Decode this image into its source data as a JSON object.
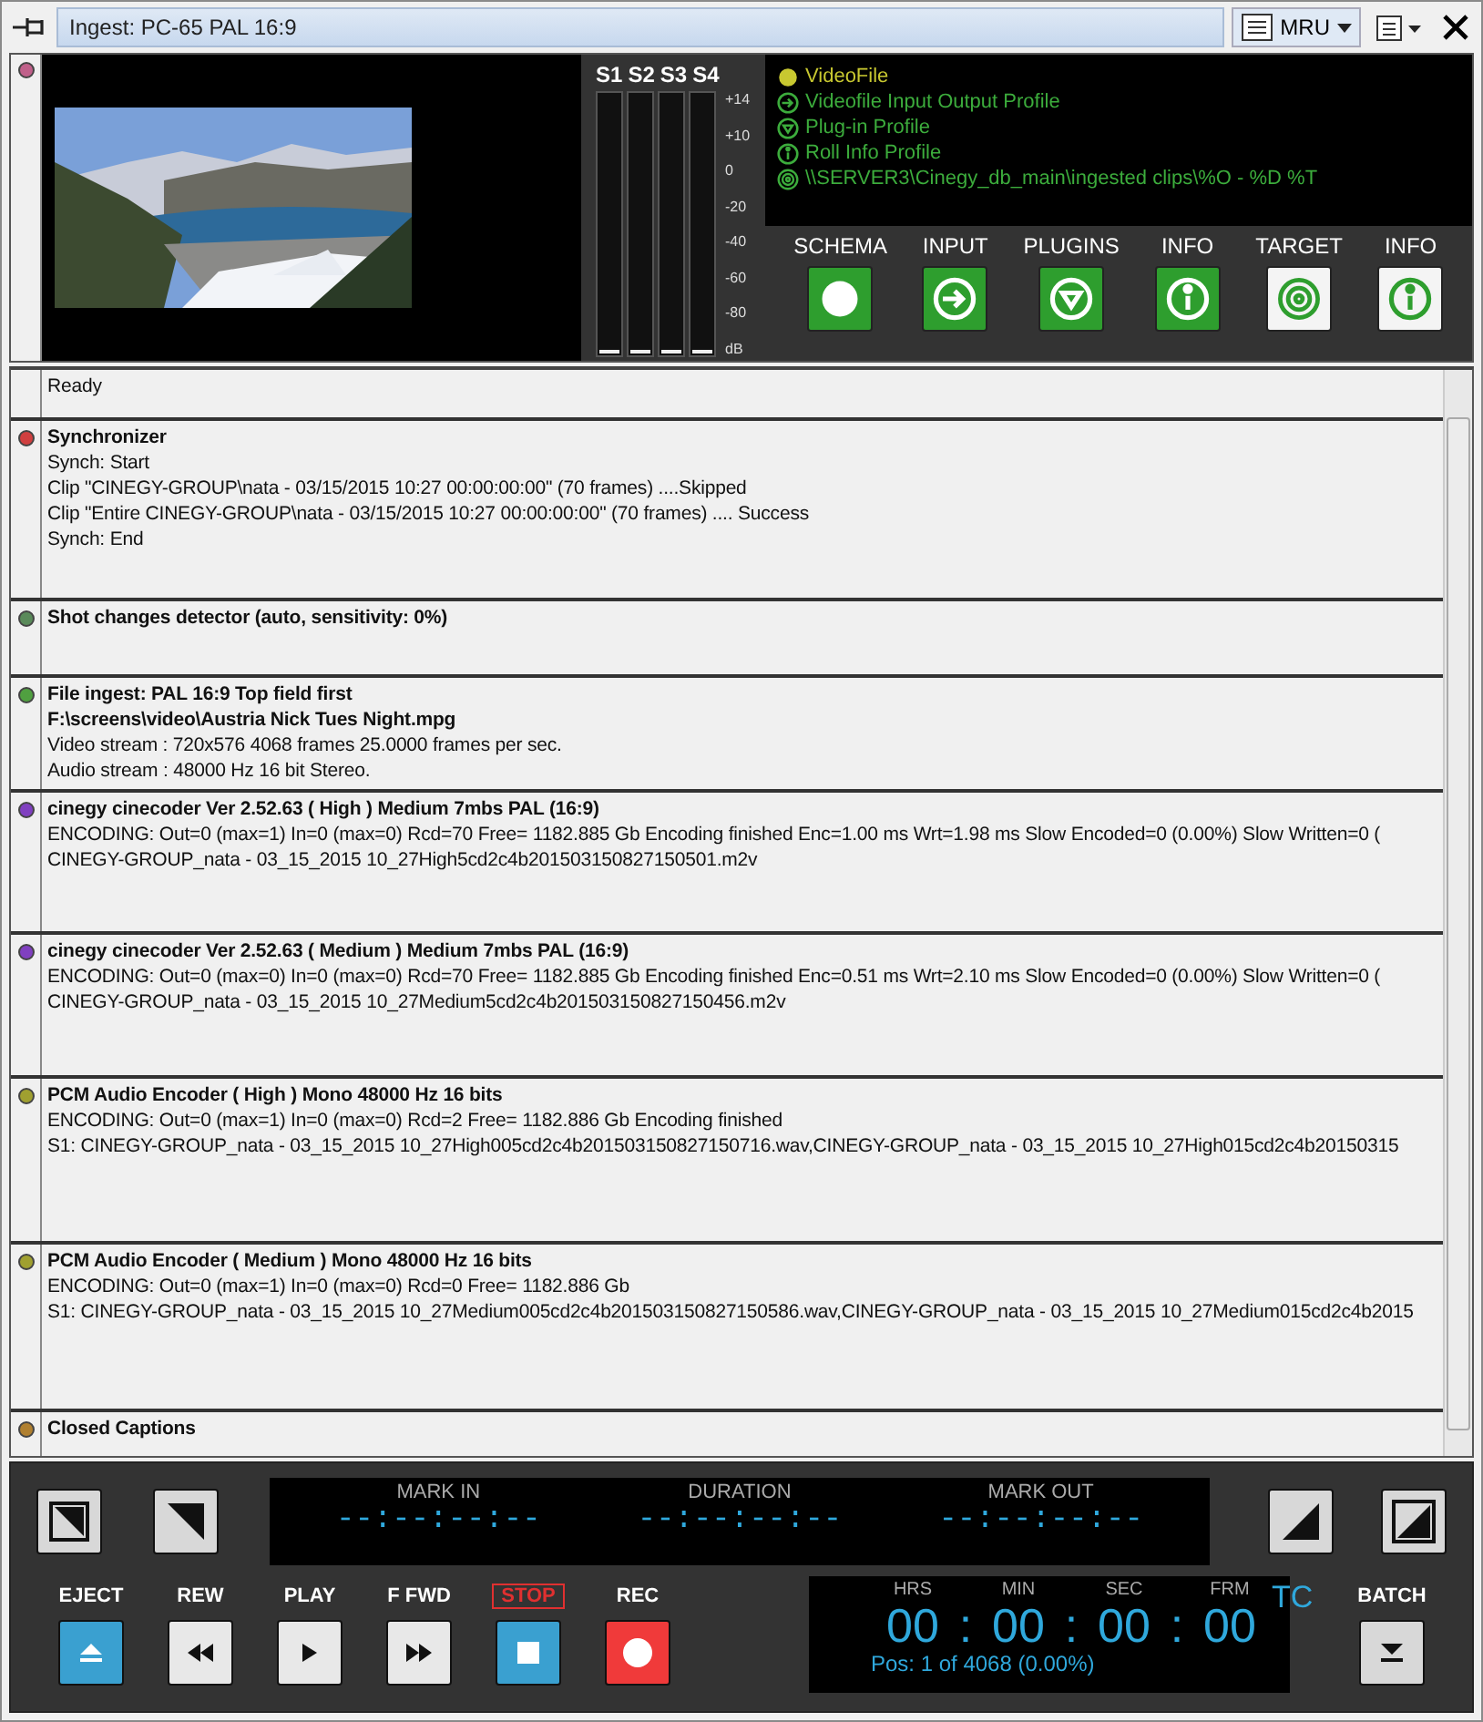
{
  "window": {
    "title": "Ingest: PC-65 PAL 16:9",
    "mru_label": "MRU"
  },
  "meters": {
    "channels": [
      "S1",
      "S2",
      "S3",
      "S4"
    ],
    "scale": [
      "+14",
      "+10",
      "0",
      "-20",
      "-40",
      "-60",
      "-80",
      "dB"
    ]
  },
  "profiles": [
    {
      "kind": "dot",
      "label": "VideoFile",
      "active": true
    },
    {
      "kind": "input",
      "label": "Videofile Input Output Profile",
      "active": false
    },
    {
      "kind": "plugin",
      "label": "Plug-in Profile",
      "active": false
    },
    {
      "kind": "info",
      "label": "Roll Info Profile",
      "active": false
    },
    {
      "kind": "target",
      "label": "\\\\SERVER3\\Cinegy_db_main\\ingested clips\\%O - %D %T",
      "active": false
    }
  ],
  "schema_buttons": [
    {
      "label": "SCHEMA",
      "kind": "dot",
      "filled": true
    },
    {
      "label": "INPUT",
      "kind": "input",
      "filled": true
    },
    {
      "label": "PLUGINS",
      "kind": "plugin",
      "filled": true
    },
    {
      "label": "INFO",
      "kind": "info",
      "filled": true
    },
    {
      "label": "TARGET",
      "kind": "target",
      "filled": false
    },
    {
      "label": "INFO",
      "kind": "info",
      "filled": false
    }
  ],
  "log": [
    {
      "lines": [
        "Ready"
      ]
    },
    {
      "title": "Synchronizer",
      "color": "#d04040",
      "lines": [
        "Synch: Start",
        "Clip \"CINEGY-GROUP\\nata - 03/15/2015 10:27 00:00:00:00\" (70 frames) ....Skipped",
        "Clip \"Entire CINEGY-GROUP\\nata - 03/15/2015 10:27 00:00:00:00\" (70 frames) .... Success",
        "Synch: End"
      ]
    },
    {
      "title": "Shot changes detector (auto, sensitivity: 0%)",
      "color": "#5a8a5a"
    },
    {
      "title": "File ingest: PAL 16:9 Top field first",
      "color": "#50a040",
      "lines": [
        "**F:\\screens\\video\\Austria Nick Tues Night.mpg**",
        "Video stream : 720x576 4068 frames 25.0000 frames per sec.",
        "Audio stream : 48000 Hz 16 bit Stereo."
      ]
    },
    {
      "title": "cinegy cinecoder Ver 2.52.63 ( High ) Medium 7mbs PAL (16:9)",
      "color": "#8040c0",
      "lines": [
        "ENCODING: Out=0 (max=1) In=0 (max=0) Rcd=70 Free= 1182.885 Gb   Encoding finished Enc=1.00 ms Wrt=1.98 ms Slow Encoded=0 (0.00%) Slow Written=0 (",
        "CINEGY-GROUP_nata - 03_15_2015 10_27High5cd2c4b201503150827150501.m2v"
      ]
    },
    {
      "title": "cinegy cinecoder Ver 2.52.63 ( Medium ) Medium 7mbs PAL (16:9)",
      "color": "#8040c0",
      "lines": [
        "ENCODING: Out=0 (max=0) In=0 (max=0) Rcd=70 Free= 1182.885 Gb   Encoding finished Enc=0.51 ms Wrt=2.10 ms Slow Encoded=0 (0.00%) Slow Written=0 (",
        "CINEGY-GROUP_nata - 03_15_2015 10_27Medium5cd2c4b201503150827150456.m2v"
      ]
    },
    {
      "title": "PCM Audio Encoder ( High )  Mono 48000 Hz 16 bits",
      "color": "#a0a030",
      "lines": [
        "ENCODING: Out=0 (max=1) In=0 (max=0) Rcd=2 Free= 1182.886 Gb   Encoding finished",
        "S1: CINEGY-GROUP_nata - 03_15_2015 10_27High005cd2c4b201503150827150716.wav,CINEGY-GROUP_nata - 03_15_2015 10_27High015cd2c4b20150315"
      ]
    },
    {
      "title": "PCM Audio Encoder ( Medium )  Mono 48000 Hz 16 bits",
      "color": "#a0a030",
      "lines": [
        "ENCODING: Out=0 (max=1) In=0 (max=0) Rcd=0 Free= 1182.886 Gb",
        "S1: CINEGY-GROUP_nata - 03_15_2015 10_27Medium005cd2c4b201503150827150586.wav,CINEGY-GROUP_nata - 03_15_2015 10_27Medium015cd2c4b2015"
      ]
    },
    {
      "title": "Closed Captions",
      "color": "#b08030"
    }
  ],
  "markers": {
    "labels": [
      "MARK IN",
      "DURATION",
      "MARK OUT"
    ],
    "values": [
      "--:--:--:--",
      "--:--:--:--",
      "--:--:--:--"
    ]
  },
  "transport": [
    {
      "kind": "eject",
      "label": "EJECT",
      "color": "#3aa0d0",
      "highlighted": false
    },
    {
      "kind": "rew",
      "label": "REW",
      "color": "#e8e8e8",
      "highlighted": false
    },
    {
      "kind": "play",
      "label": "PLAY",
      "color": "#e8e8e8",
      "highlighted": false
    },
    {
      "kind": "ffwd",
      "label": "F FWD",
      "color": "#e8e8e8",
      "highlighted": false
    },
    {
      "kind": "stop",
      "label": "STOP",
      "color": "#3aa0d0",
      "highlighted": true
    },
    {
      "kind": "rec",
      "label": "REC",
      "color": "#f03a3a",
      "highlighted": false
    }
  ],
  "timecode": {
    "units": [
      {
        "label": "HRS",
        "value": "00"
      },
      {
        "label": "MIN",
        "value": "00"
      },
      {
        "label": "SEC",
        "value": "00"
      },
      {
        "label": "FRM",
        "value": "00"
      }
    ],
    "separator": ":",
    "mode": "TC",
    "position": "Pos: 1 of 4068 (0.00%)"
  },
  "batch": {
    "label": "BATCH"
  }
}
